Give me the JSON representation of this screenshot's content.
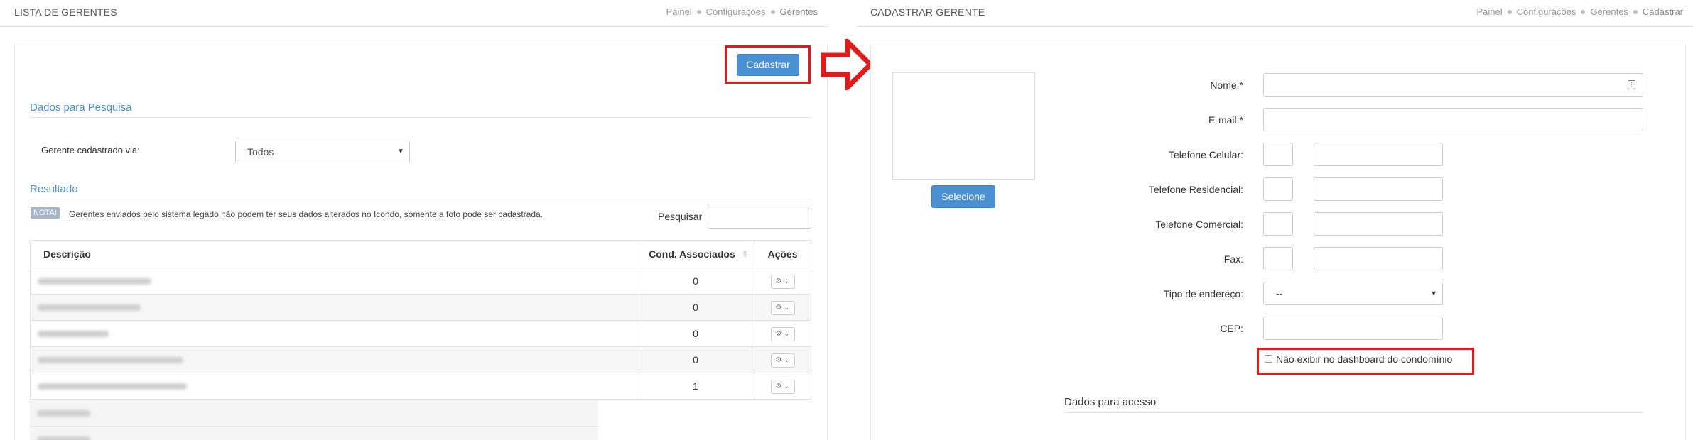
{
  "left": {
    "title": "LISTA DE GERENTES",
    "breadcrumb": [
      "Painel",
      "Configurações",
      "Gerentes"
    ],
    "cadastrar_label": "Cadastrar",
    "search_section": "Dados para Pesquisa",
    "filter_label": "Gerente cadastrado via:",
    "filter_value": "Todos",
    "result_section": "Resultado",
    "note_badge": "NOTA!",
    "note_text": "Gerentes enviados pelo sistema legado não podem ter seus dados alterados no Icondo, somente a foto pode ser cadastrada.",
    "search_label": "Pesquisar",
    "table": {
      "headers": [
        "Descrição",
        "Cond. Associados",
        "Ações"
      ],
      "rows": [
        {
          "name_blur": "Alessandra Leite Oliveira",
          "count": "0"
        },
        {
          "name_blur": "André Luis de Oliveira",
          "count": "0"
        },
        {
          "name_blur": "Ariel Rodrigues",
          "count": "0"
        },
        {
          "name_blur": "Caroline Cristina Nunes Correa",
          "count": "0"
        },
        {
          "name_blur": "Danielle Pereira de Castro Lobo",
          "count": "1"
        }
      ],
      "tail_rows": [
        "ENTIDADE 13895",
        "ENTIDADE 13893"
      ]
    }
  },
  "right": {
    "title": "CADASTRAR GERENTE",
    "breadcrumb": [
      "Painel",
      "Configurações",
      "Gerentes",
      "Cadastrar"
    ],
    "photo_button": "Selecione",
    "fields": {
      "nome": "Nome:*",
      "email": "E-mail:*",
      "celular": "Telefone Celular:",
      "residencial": "Telefone Residencial:",
      "comercial": "Telefone Comercial:",
      "fax": "Fax:",
      "tipo_endereco": "Tipo de endereço:",
      "cep": "CEP:"
    },
    "tipo_endereco_value": "--",
    "checkbox_label": "Não exibir no dashboard do condomínio",
    "access_section": "Dados para acesso"
  },
  "colors": {
    "accent": "#4a90d2",
    "highlight": "#e21a1a"
  }
}
